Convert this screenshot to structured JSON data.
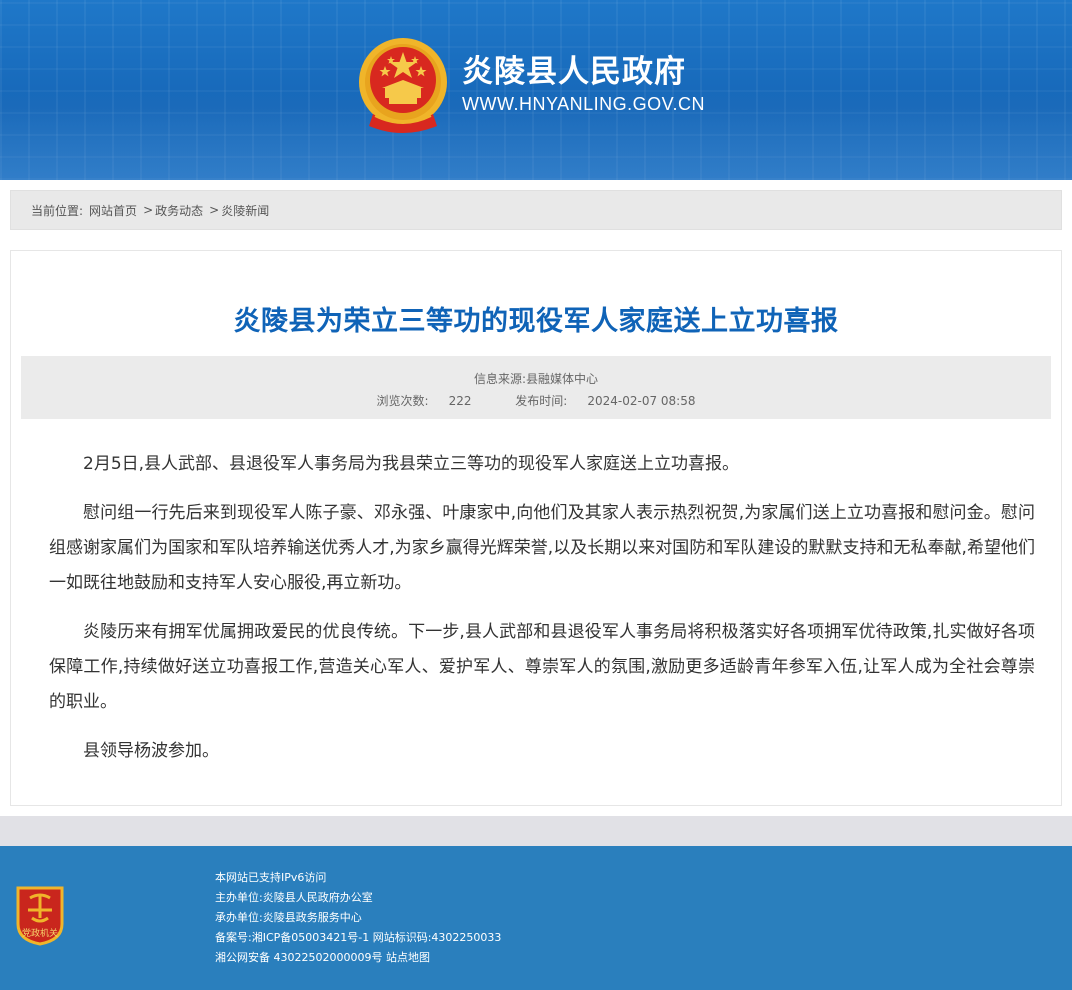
{
  "header": {
    "site_title": "炎陵县人民政府",
    "site_url": "WWW.HNYANLING.GOV.CN"
  },
  "breadcrumb": {
    "label": "当前位置:",
    "items": [
      "网站首页",
      "政务动态",
      "炎陵新闻"
    ],
    "separator": ">"
  },
  "article": {
    "title": "炎陵县为荣立三等功的现役军人家庭送上立功喜报",
    "source": "信息来源:县融媒体中心",
    "views_label": "浏览次数:",
    "views": "222",
    "publish_label": "发布时间:",
    "publish_time": "2024-02-07 08:58",
    "paragraphs": [
      "2月5日,县人武部、县退役军人事务局为我县荣立三等功的现役军人家庭送上立功喜报。",
      "慰问组一行先后来到现役军人陈子豪、邓永强、叶康家中,向他们及其家人表示热烈祝贺,为家属们送上立功喜报和慰问金。慰问组感谢家属们为国家和军队培养输送优秀人才,为家乡赢得光辉荣誉,以及长期以来对国防和军队建设的默默支持和无私奉献,希望他们一如既往地鼓励和支持军人安心服役,再立新功。",
      "炎陵历来有拥军优属拥政爱民的优良传统。下一步,县人武部和县退役军人事务局将积极落实好各项拥军优待政策,扎实做好各项保障工作,持续做好送立功喜报工作,营造关心军人、爱护军人、尊崇军人的氛围,激励更多适龄青年参军入伍,让军人成为全社会尊崇的职业。",
      "县领导杨波参加。"
    ]
  },
  "footer": {
    "logo_text": "党政机关",
    "lines": [
      "本网站已支持IPv6访问",
      "主办单位:炎陵县人民政府办公室",
      "承办单位:炎陵县政务服务中心",
      "备案号:湘ICP备05003421号-1 网站标识码:4302250033",
      "湘公网安备 43022502000009号 站点地图"
    ]
  },
  "colors": {
    "header_blue": "#1667b8",
    "title_blue": "#0f63b7",
    "footer_blue": "#2a7fbd",
    "emblem_red": "#d8281f",
    "emblem_gold": "#f0b52a"
  }
}
